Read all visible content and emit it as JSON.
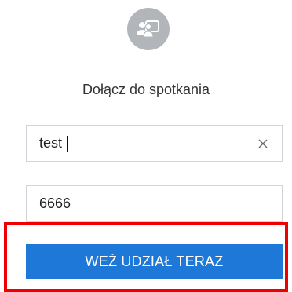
{
  "header": {
    "icon": "join-meeting-icon",
    "title": "Dołącz do spotkania"
  },
  "form": {
    "name_value": "test",
    "clear_icon": "close-icon",
    "meeting_id_value": "6666",
    "join_button_label": "WEŹ UDZIAŁ TERAZ"
  },
  "colors": {
    "accent": "#1e78d7",
    "icon_circle": "#b2b5b9",
    "highlight": "#ee0000"
  }
}
